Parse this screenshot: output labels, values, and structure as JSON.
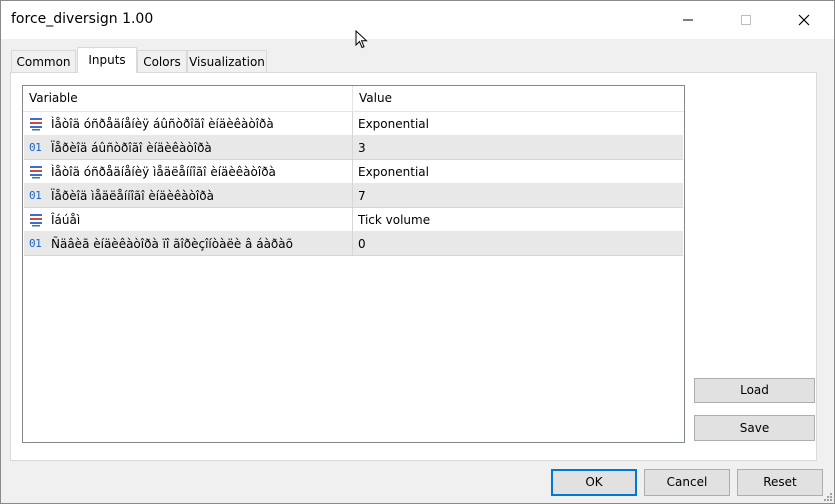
{
  "window": {
    "title": "force_diversign 1.00"
  },
  "tabs": [
    {
      "label": "Common"
    },
    {
      "label": "Inputs"
    },
    {
      "label": "Colors"
    },
    {
      "label": "Visualization"
    }
  ],
  "active_tab": "Inputs",
  "table": {
    "headers": {
      "variable": "Variable",
      "value": "Value"
    },
    "rows": [
      {
        "icon": "enum-list-icon",
        "variable": "Ìåòîä óñðåäíåíèÿ áûñòðîãî èíäèêàòîðà",
        "value": "Exponential"
      },
      {
        "icon": "integer-01-icon",
        "variable": "Ïåðèîä áûñòðîãî èíäèêàòîðà",
        "value": "3"
      },
      {
        "icon": "enum-list-icon",
        "variable": "Ìåòîä óñðåäíåíèÿ ìåäëåííîãî èíäèêàòîðà",
        "value": "Exponential"
      },
      {
        "icon": "integer-01-icon",
        "variable": "Ïåðèîä ìåäëåííîãî èíäèêàòîðà",
        "value": "7"
      },
      {
        "icon": "enum-list-icon",
        "variable": "Îáúåì",
        "value": "Tick volume"
      },
      {
        "icon": "integer-01-icon",
        "variable": "Ñäâèã èíäèêàòîðà ïî ãîðèçîíòàëè â áàðàõ",
        "value": "0"
      }
    ]
  },
  "side_buttons": {
    "load": "Load",
    "save": "Save"
  },
  "footer_buttons": {
    "ok": "OK",
    "cancel": "Cancel",
    "reset": "Reset"
  },
  "icon_text": {
    "integer": "01"
  },
  "colors": {
    "focus_border": "#0078d7",
    "integer_icon": "#1a63c9",
    "enum_icon_blue": "#3a6fd0",
    "enum_icon_red": "#d04a3a",
    "alt_row": "#e8e8e8"
  }
}
